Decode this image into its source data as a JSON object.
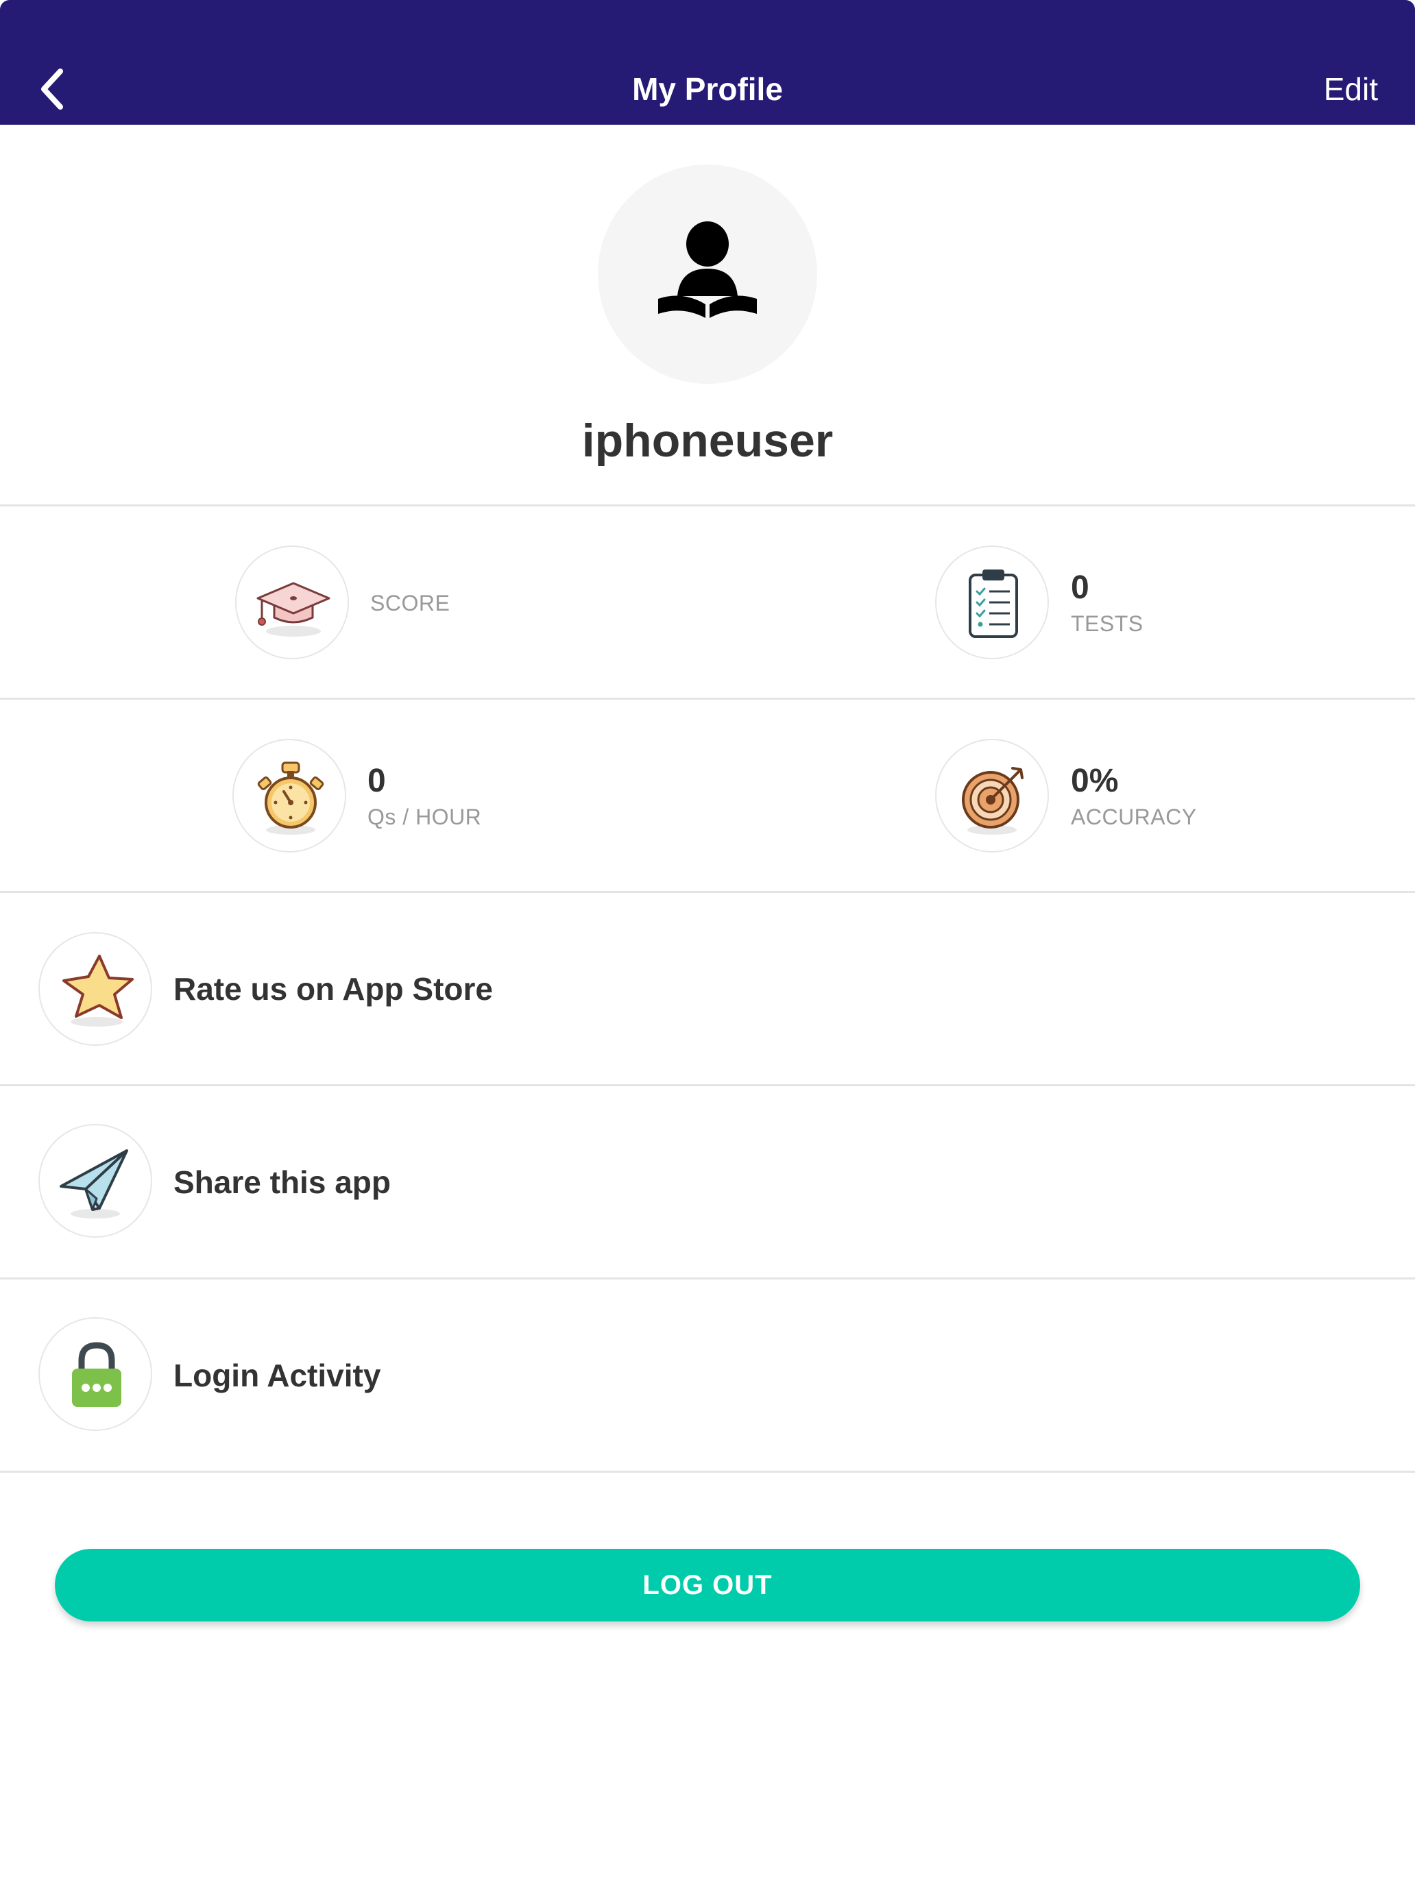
{
  "nav": {
    "title": "My Profile",
    "edit_label": "Edit"
  },
  "profile": {
    "username": "iphoneuser"
  },
  "stats": [
    {
      "icon": "graduation-cap-icon",
      "value": "",
      "label": "SCORE"
    },
    {
      "icon": "clipboard-checklist-icon",
      "value": "0",
      "label": "TESTS"
    },
    {
      "icon": "stopwatch-icon",
      "value": "0",
      "label": "Qs / HOUR"
    },
    {
      "icon": "target-icon",
      "value": "0%",
      "label": "ACCURACY"
    }
  ],
  "menu": [
    {
      "icon": "star-icon",
      "label": "Rate us on App Store"
    },
    {
      "icon": "paper-plane-icon",
      "label": "Share this app"
    },
    {
      "icon": "lock-icon",
      "label": "Login Activity"
    }
  ],
  "logout_label": "LOG OUT",
  "colors": {
    "nav_bg": "#251b74",
    "accent": "#00ccab",
    "text": "#333333",
    "muted": "#999999",
    "divider": "#e4e4e4"
  }
}
